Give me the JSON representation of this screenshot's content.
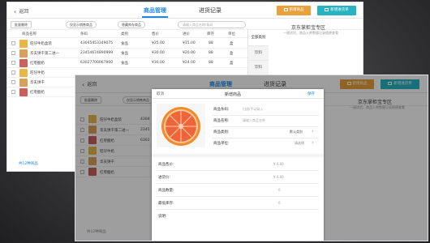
{
  "back_screen": {
    "back_label": "返回",
    "tab_goods": "商品管理",
    "tab_records": "进货记录",
    "btn_new_goods": "新增商品",
    "btn_new_supplier": "新增进货单",
    "batch_delete": "批量删除",
    "pill_store": "仅显示销售商品",
    "pill_hidden": "隐藏库存商品",
    "search_placeholder": "请输入商品名称/条码",
    "columns": [
      "商品名称",
      "条码",
      "类别",
      "售价",
      "进价",
      "库存",
      "单位"
    ],
    "rows": [
      {
        "name": "旺仔牛奶盒装",
        "code": "43045453349075",
        "cat": "食品",
        "price": "¥25.00",
        "cost": "¥15.00",
        "stock": "88",
        "unit": "盒"
      },
      {
        "name": "华夫饼干第二进一",
        "code": "23454674890999",
        "cat": "食品",
        "price": "¥30.00",
        "cost": "¥20.00",
        "stock": "88",
        "unit": "盒"
      },
      {
        "name": "红枣酸奶",
        "code": "63027700067900",
        "cat": "食品",
        "price": "¥30.00",
        "cost": "¥24.00",
        "stock": "88",
        "unit": "盒"
      },
      {
        "name": "旺仔牛奶",
        "code": "",
        "cat": "",
        "price": "",
        "cost": "",
        "stock": "",
        "unit": ""
      },
      {
        "name": "华夫饼干",
        "code": "",
        "cat": "",
        "price": "",
        "cost": "",
        "stock": "",
        "unit": ""
      },
      {
        "name": "红枣酸奶",
        "code": "",
        "cat": "",
        "price": "",
        "cost": "",
        "stock": "",
        "unit": ""
      }
    ],
    "side_items": [
      "全部类别",
      "饮料",
      "饮料"
    ],
    "right_title": "京东掌柜宝专区",
    "right_sub": "一键进货，商品入库数量记录随便查看",
    "footer": "共12种商品"
  },
  "front_screen": {
    "back_label": "返回",
    "tab_goods": "商品管理",
    "tab_records": "进货记录",
    "btn_new_goods": "新增商品",
    "btn_new_supplier": "新增进货单",
    "batch_delete": "批量删除",
    "pill_store": "仅显示销售商品",
    "right_title": "京东掌柜宝专区",
    "right_sub": "一键进货，商品入库数量记录随便查看",
    "footer": "共12种商品",
    "row_names": [
      "旺仔牛奶盒装",
      "华夫饼干第二进一",
      "红枣酸奶",
      "旺仔牛奶",
      "华夫饼干",
      "红枣酸奶"
    ],
    "row_codes": [
      "4304",
      "2345",
      "6302",
      "",
      "",
      ""
    ]
  },
  "modal": {
    "cancel": "取消",
    "title": "新增商品",
    "save": "保存",
    "fields": [
      {
        "label": "商品条码:",
        "value": "扫描/手动录入"
      },
      {
        "label": "商品名称:",
        "value": "请输入商品名称"
      },
      {
        "label": "商品类别:",
        "value": "默认类别"
      },
      {
        "label": "商品单位:",
        "value": "请选择"
      }
    ],
    "price_fields": [
      {
        "label": "商品售价:",
        "value": "¥ 0.00"
      },
      {
        "label": "进货价:",
        "value": "¥ 0.00"
      },
      {
        "label": "商品数量:",
        "value": "0"
      },
      {
        "label": "最低库存:",
        "value": "0"
      },
      {
        "label": "说明:",
        "value": ""
      }
    ]
  },
  "colors": {
    "accent": "#1e88e5",
    "orange": "#e9a13b",
    "teal": "#26b3c2"
  }
}
